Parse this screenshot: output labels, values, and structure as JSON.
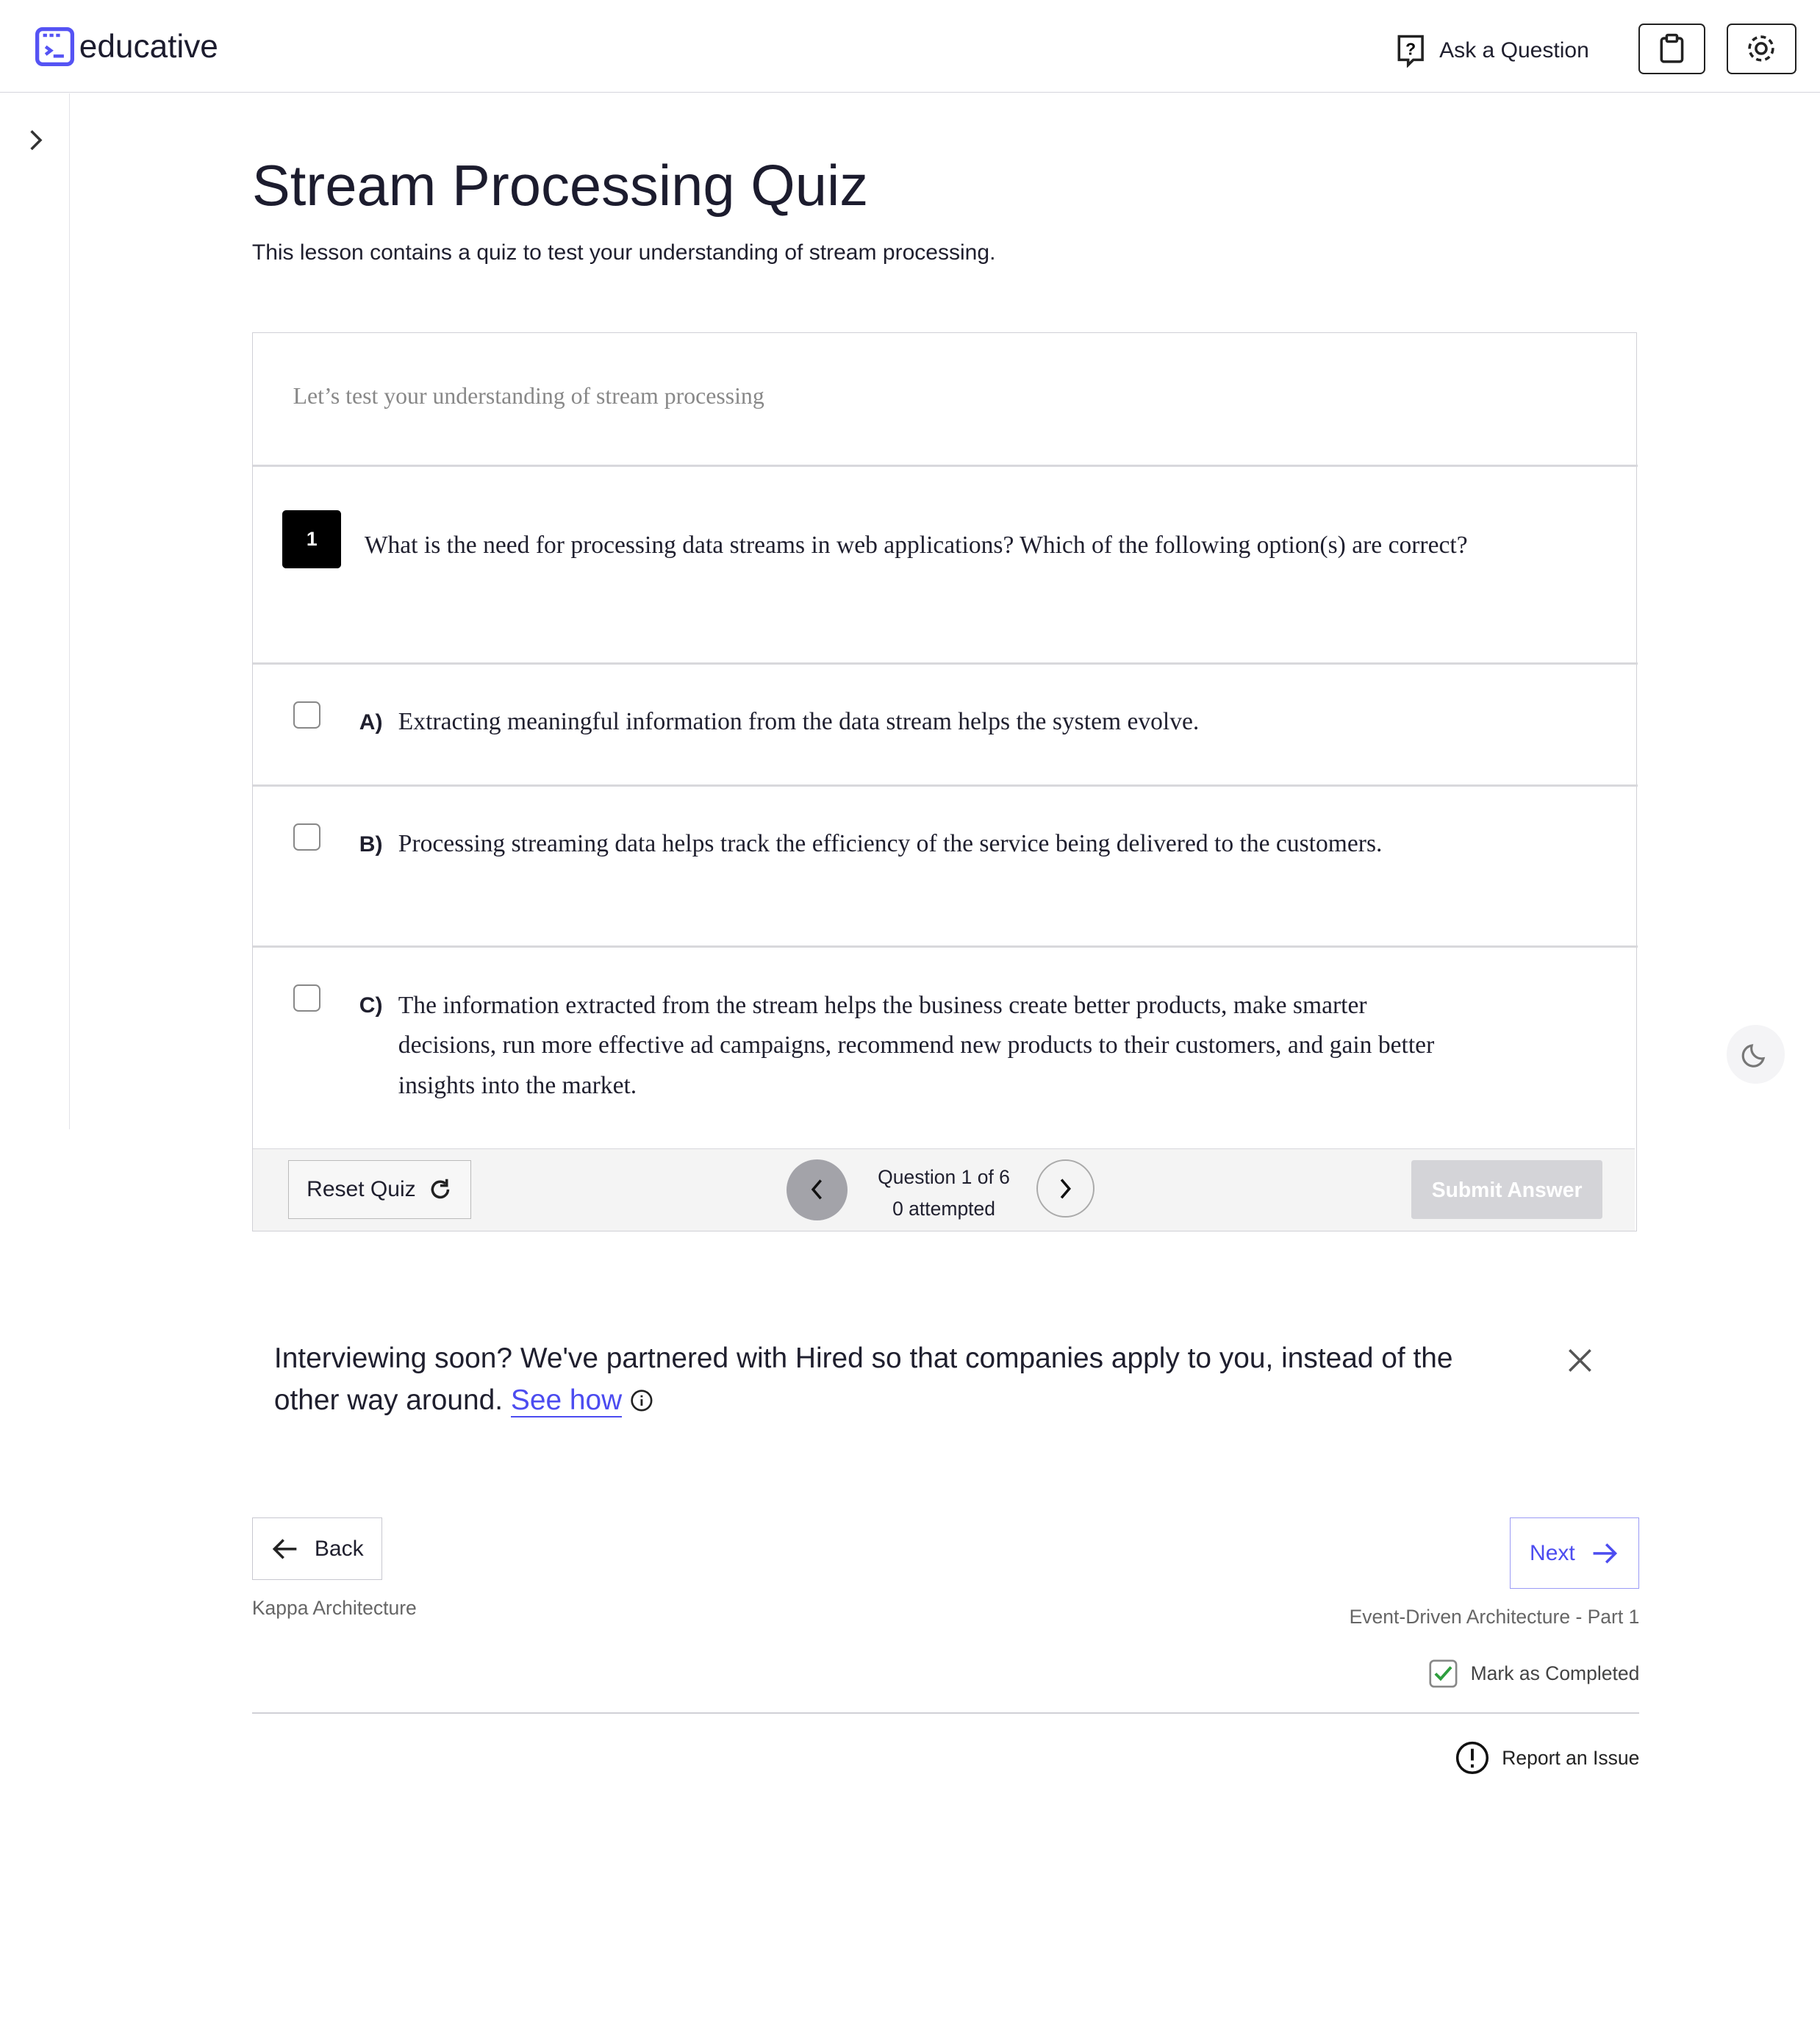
{
  "header": {
    "logo_text": "educative",
    "ask_label": "Ask a Question"
  },
  "lesson": {
    "title": "Stream Processing Quiz",
    "subtitle": "This lesson contains a quiz to test your understanding of stream processing."
  },
  "quiz": {
    "intro": "Let’s test your understanding of stream processing",
    "question_number": "1",
    "question": "What is the need for processing data streams in web applications? Which of the following option(s) are correct?",
    "options": [
      {
        "label": "A)",
        "text": "Extracting meaningful information from the data stream helps the system evolve.",
        "checked": false
      },
      {
        "label": "B)",
        "text": "Processing streaming data helps track the efficiency of the service being delivered to the customers.",
        "checked": false
      },
      {
        "label": "C)",
        "text": "The information extracted from the stream helps the business create better products, make smarter decisions, run more effective ad campaigns, recommend new products to their customers, and gain better insights into the market.",
        "checked": false
      }
    ],
    "reset_label": "Reset Quiz",
    "progress": "Question 1 of 6",
    "attempted": "0 attempted",
    "submit_label": "Submit Answer"
  },
  "promo": {
    "text": "Interviewing soon? We've partnered with Hired so that companies apply to you, instead of the other way around.",
    "link": "See how"
  },
  "nav": {
    "back_label": "Back",
    "back_lesson": "Kappa Architecture",
    "next_label": "Next",
    "next_lesson": "Event-Driven Architecture - Part 1",
    "mark_completed": "Mark as Completed",
    "report": "Report an Issue"
  },
  "colors": {
    "accent": "#4c4cf0",
    "check": "#2e9e3e"
  }
}
